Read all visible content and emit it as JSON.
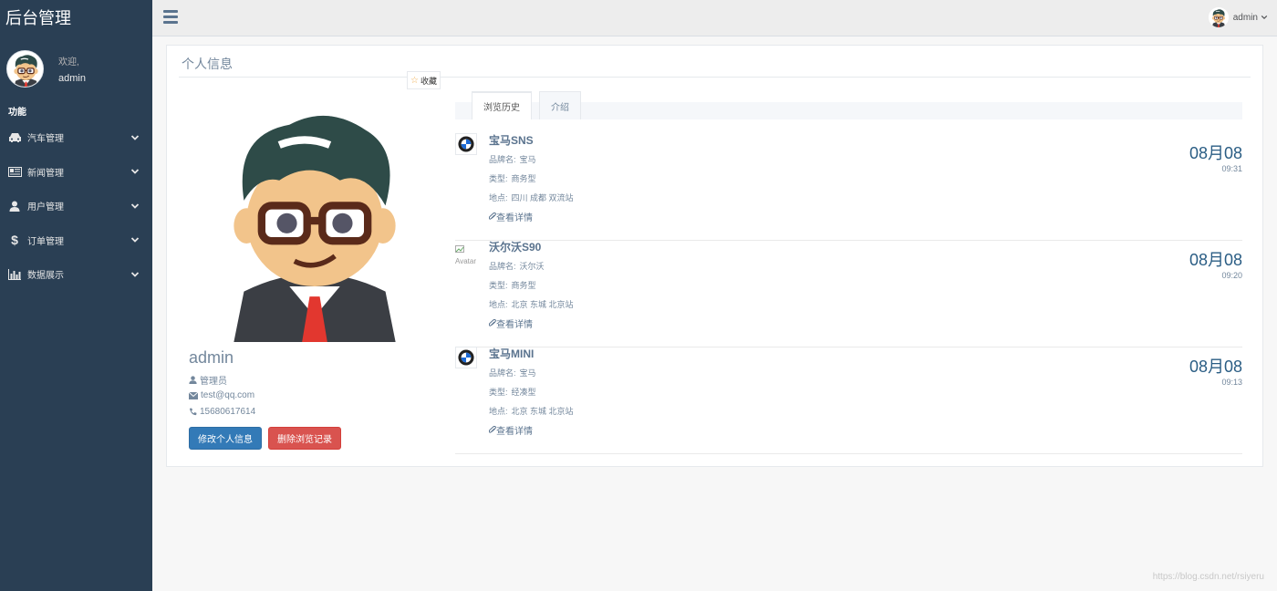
{
  "sidebar": {
    "brand": "后台管理",
    "welcome": "欢迎,",
    "username": "admin",
    "section": "功能",
    "items": [
      {
        "label": "汽车管理",
        "icon": "car-icon"
      },
      {
        "label": "新闻管理",
        "icon": "newspaper-icon"
      },
      {
        "label": "用户管理",
        "icon": "user-icon"
      },
      {
        "label": "订单管理",
        "icon": "dollar-icon"
      },
      {
        "label": "数据展示",
        "icon": "bar-chart-icon"
      }
    ]
  },
  "topbar": {
    "username": "admin"
  },
  "profile": {
    "panel_title": "个人信息",
    "favorite_label": "收藏",
    "name": "admin",
    "role": "管理员",
    "email": "test@qq.com",
    "phone": "15680617614",
    "edit_button": "修改个人信息",
    "delete_button": "删除浏览记录"
  },
  "tabs": [
    {
      "label": "浏览历史",
      "active": true
    },
    {
      "label": "介绍",
      "active": false
    }
  ],
  "history": [
    {
      "title": "宝马SNS",
      "brand_label": "品牌名:",
      "brand": "宝马",
      "type_label": "类型:",
      "type": "商务型",
      "location_label": "地点:",
      "location": "四川 成都 双流站",
      "link": "查看详情",
      "date": "08月08",
      "time": "09:31",
      "image": "bmw-logo"
    },
    {
      "title": "沃尔沃S90",
      "brand_label": "品牌名:",
      "brand": "沃尔沃",
      "type_label": "类型:",
      "type": "商务型",
      "location_label": "地点:",
      "location": "北京 东城 北京站",
      "link": "查看详情",
      "date": "08月08",
      "time": "09:20",
      "image_alt": "Avatar"
    },
    {
      "title": "宝马MINI",
      "brand_label": "品牌名:",
      "brand": "宝马",
      "type_label": "类型:",
      "type": "经凑型",
      "location_label": "地点:",
      "location": "北京 东城 北京站",
      "link": "查看详情",
      "date": "08月08",
      "time": "09:13",
      "image": "bmw-logo"
    }
  ],
  "watermark": "https://blog.csdn.net/rsiyeru"
}
